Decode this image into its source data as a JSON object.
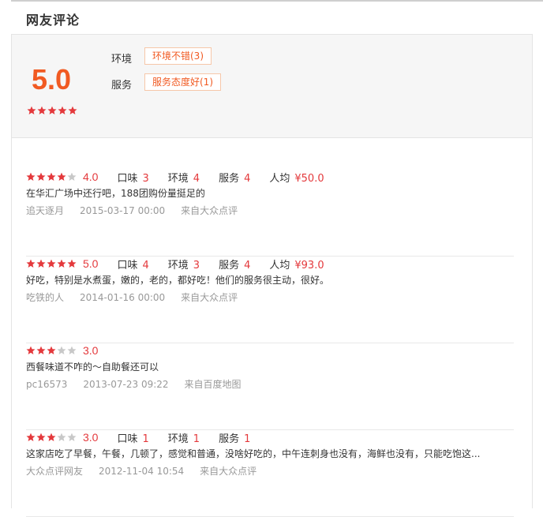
{
  "title": "网友评论",
  "colors": {
    "accent": "#f15a22",
    "star": "#e4393c",
    "star_empty": "#c8c8c8"
  },
  "summary": {
    "score": "5.0",
    "stars": 5,
    "tags": [
      {
        "label": "环境",
        "value": "环境不错(3)"
      },
      {
        "label": "服务",
        "value": "服务态度好(1)"
      }
    ]
  },
  "reviews": [
    {
      "stars": 4,
      "score": "4.0",
      "metrics": [
        {
          "label": "口味",
          "value": "3"
        },
        {
          "label": "环境",
          "value": "4"
        },
        {
          "label": "服务",
          "value": "4"
        },
        {
          "label": "人均",
          "value": "¥50.0"
        }
      ],
      "text": "在华汇广场中还行吧，188团购份量挺足的",
      "user": "追天逐月",
      "time": "2015-03-17 00:00",
      "source": "来自大众点评"
    },
    {
      "stars": 5,
      "score": "5.0",
      "metrics": [
        {
          "label": "口味",
          "value": "4"
        },
        {
          "label": "环境",
          "value": "3"
        },
        {
          "label": "服务",
          "value": "4"
        },
        {
          "label": "人均",
          "value": "¥93.0"
        }
      ],
      "text": "好吃，特别是水煮蛋，嫩的，老的，都好吃！他们的服务很主动，很好。",
      "user": "吃铁的人",
      "time": "2014-01-16 00:00",
      "source": "来自大众点评"
    },
    {
      "stars": 3,
      "score": "3.0",
      "metrics": [],
      "text": "西餐味道不咋的～自助餐还可以",
      "user": "pc16573",
      "time": "2013-07-23 09:22",
      "source": "来自百度地图"
    },
    {
      "stars": 3,
      "score": "3.0",
      "metrics": [
        {
          "label": "口味",
          "value": "1"
        },
        {
          "label": "环境",
          "value": "1"
        },
        {
          "label": "服务",
          "value": "1"
        }
      ],
      "text": "这家店吃了早餐，午餐，几顿了，感觉和普通，没啥好吃的，中午连刺身也没有，海鲜也没有，只能吃饱这...",
      "user": "大众点评网友",
      "time": "2012-11-04 10:54",
      "source": "来自大众点评"
    }
  ]
}
